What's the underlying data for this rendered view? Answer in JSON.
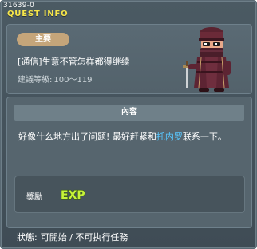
{
  "window": {
    "quest_id": "31639-0",
    "title": "QUEST INFO"
  },
  "summary": {
    "type_tag": "主要",
    "quest_name": "[通信]生意不管怎样都得继续",
    "level_label": "建議等級:",
    "level_range": "100～119"
  },
  "content": {
    "header": "內容",
    "text_before_npc": "好像什么地方出了问题! 最好赶紧和",
    "npc_name": "托内罗",
    "text_after_npc": "联系一下。",
    "npc_name_color": "#58c7ff"
  },
  "reward": {
    "label": "獎勵",
    "exp_text": "EXP"
  },
  "status": {
    "label": "狀態:",
    "value": "可開始 / 不可执行任務"
  },
  "colors": {
    "title": "#f6e64a",
    "type_tag": "#c5a57a",
    "exp": "#c6f23a"
  },
  "icons": [
    "npc-portrait-icon",
    "exp-icon"
  ]
}
